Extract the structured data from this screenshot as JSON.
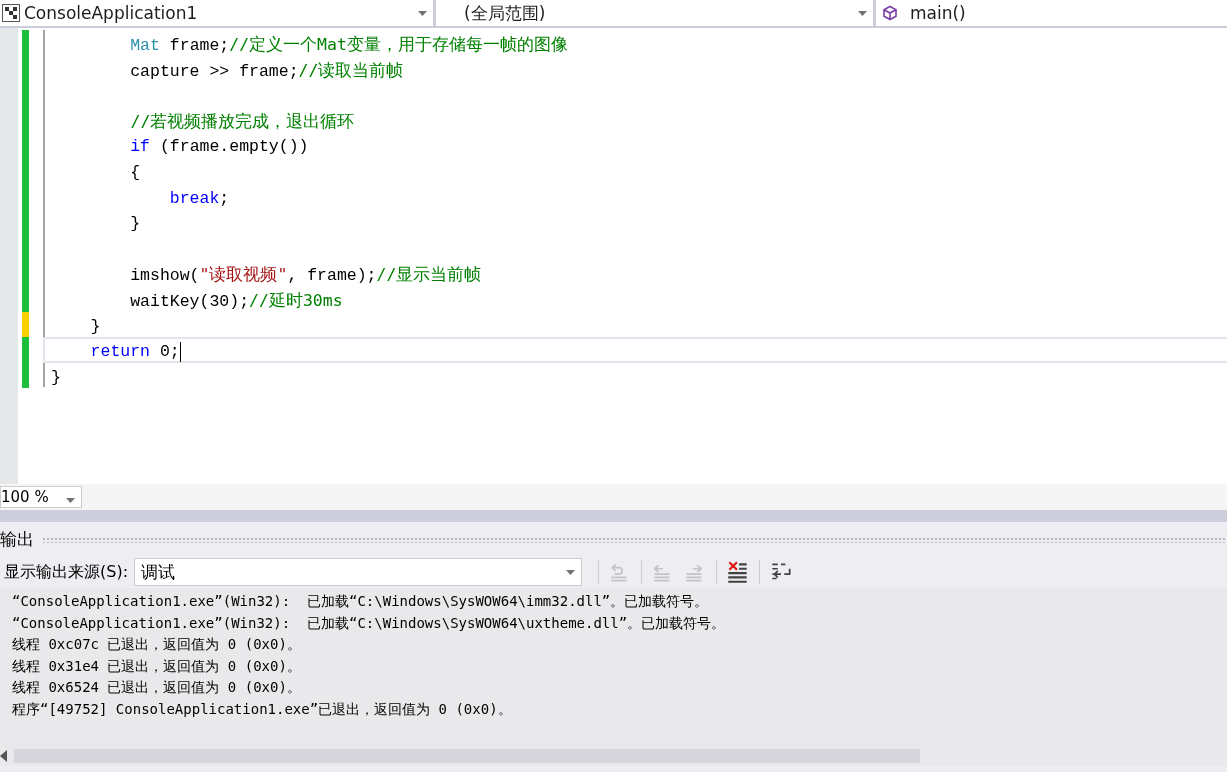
{
  "navigation_bar": {
    "project": "ConsoleApplication1",
    "scope": "(全局范围)",
    "member": "main()"
  },
  "editor": {
    "lines": [
      {
        "saved": true,
        "current": false,
        "tokens": [
          {
            "kind": "type",
            "text": "        Mat"
          },
          {
            "kind": "plain",
            "text": " frame;"
          },
          {
            "kind": "comment",
            "text": "//定义一个Mat变量，用于存储每一帧的图像"
          }
        ]
      },
      {
        "saved": true,
        "current": false,
        "tokens": [
          {
            "kind": "plain",
            "text": "        capture >> frame;"
          },
          {
            "kind": "comment",
            "text": "//读取当前帧"
          }
        ]
      },
      {
        "saved": true,
        "current": false
      },
      {
        "saved": true,
        "current": false,
        "tokens": [
          {
            "kind": "comment",
            "text": "        //若视频播放完成，退出循环"
          }
        ]
      },
      {
        "saved": true,
        "current": false,
        "tokens": [
          {
            "kind": "keyword",
            "text": "        if"
          },
          {
            "kind": "plain",
            "text": " (frame.empty())"
          }
        ]
      },
      {
        "saved": true,
        "current": false,
        "tokens": [
          {
            "kind": "plain",
            "text": "        {"
          }
        ]
      },
      {
        "saved": true,
        "current": false,
        "tokens": [
          {
            "kind": "keyword",
            "text": "            break"
          },
          {
            "kind": "plain",
            "text": ";"
          }
        ]
      },
      {
        "saved": true,
        "current": false,
        "tokens": [
          {
            "kind": "plain",
            "text": "        }"
          }
        ]
      },
      {
        "saved": true,
        "current": false
      },
      {
        "saved": true,
        "current": false,
        "tokens": [
          {
            "kind": "plain",
            "text": "        imshow("
          },
          {
            "kind": "string",
            "text": "\"读取视频\""
          },
          {
            "kind": "plain",
            "text": ", frame);"
          },
          {
            "kind": "comment",
            "text": "//显示当前帧"
          }
        ]
      },
      {
        "saved": true,
        "current": false,
        "tokens": [
          {
            "kind": "plain",
            "text": "        waitKey(30);"
          },
          {
            "kind": "comment",
            "text": "//延时30ms"
          }
        ]
      },
      {
        "saved": false,
        "current": false,
        "tokens": [
          {
            "kind": "plain",
            "text": "    }"
          }
        ]
      },
      {
        "saved": true,
        "current": true,
        "tokens": [
          {
            "kind": "keyword",
            "text": "    return"
          },
          {
            "kind": "plain",
            "text": " 0;"
          }
        ]
      },
      {
        "saved": true,
        "current": false,
        "tokens": [
          {
            "kind": "plain",
            "text": "}"
          }
        ]
      }
    ],
    "zoom": "100 %"
  },
  "output": {
    "title": "输出",
    "source_label": "显示输出来源(S):",
    "source": "调试",
    "toolbar": [
      {
        "kind": "goto-source",
        "disabled": true
      },
      {
        "kind": "prev-message",
        "disabled": true
      },
      {
        "kind": "next-message",
        "disabled": true
      },
      {
        "kind": "clear-all",
        "disabled": false
      },
      {
        "kind": "word-wrap",
        "disabled": false
      }
    ],
    "lines": [
      "“ConsoleApplication1.exe”(Win32):  已加载“C:\\Windows\\SysWOW64\\imm32.dll”。已加载符号。",
      "“ConsoleApplication1.exe”(Win32):  已加载“C:\\Windows\\SysWOW64\\uxtheme.dll”。已加载符号。",
      "线程 0xc07c 已退出，返回值为 0 (0x0)。",
      "线程 0x31e4 已退出，返回值为 0 (0x0)。",
      "线程 0x6524 已退出，返回值为 0 (0x0)。",
      "程序“[49752] ConsoleApplication1.exe”已退出，返回值为 0 (0x0)。"
    ]
  }
}
